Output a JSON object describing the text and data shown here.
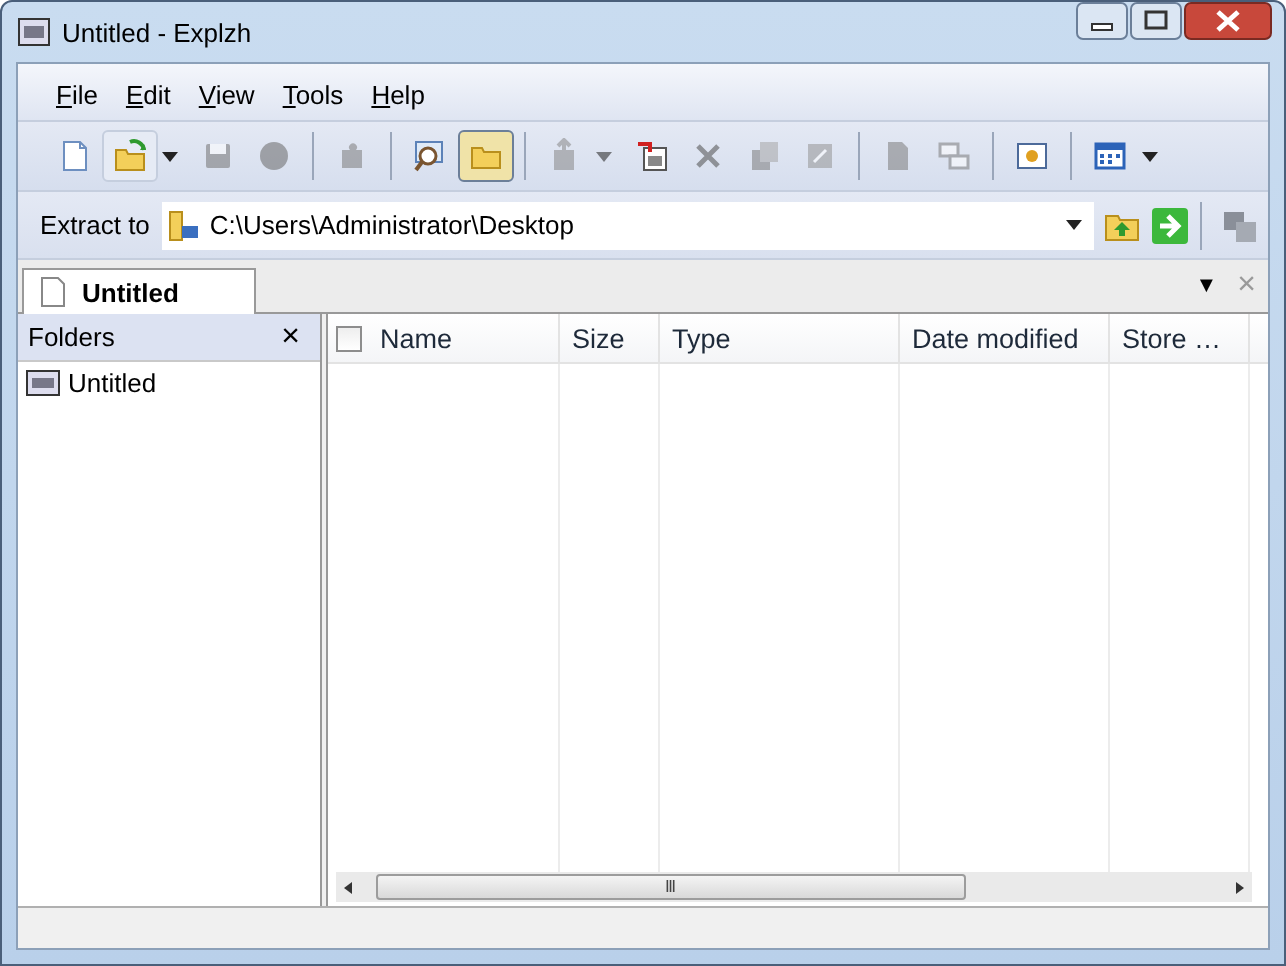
{
  "window": {
    "title": "Untitled - Explzh"
  },
  "menu": [
    "File",
    "Edit",
    "View",
    "Tools",
    "Help"
  ],
  "toolbar": [
    {
      "kind": "button",
      "disabled": false,
      "selected": false
    },
    {
      "kind": "split",
      "disabled": false,
      "selected": false
    },
    {
      "kind": "button",
      "disabled": true,
      "selected": false
    },
    {
      "kind": "button",
      "disabled": true,
      "selected": false
    },
    {
      "kind": "separator"
    },
    {
      "kind": "button",
      "disabled": true,
      "selected": false
    },
    {
      "kind": "separator"
    },
    {
      "kind": "button",
      "disabled": false,
      "selected": false
    },
    {
      "kind": "button",
      "disabled": false,
      "selected": true
    },
    {
      "kind": "separator"
    },
    {
      "kind": "split",
      "disabled": true,
      "selected": false
    },
    {
      "kind": "button",
      "disabled": false,
      "selected": false
    },
    {
      "kind": "button",
      "disabled": true,
      "selected": false
    },
    {
      "kind": "button",
      "disabled": true,
      "selected": false
    },
    {
      "kind": "button",
      "disabled": true,
      "selected": false
    },
    {
      "kind": "separator"
    },
    {
      "kind": "button",
      "disabled": true,
      "selected": false
    },
    {
      "kind": "button",
      "disabled": true,
      "selected": false
    },
    {
      "kind": "separator"
    },
    {
      "kind": "button",
      "disabled": false,
      "selected": false
    },
    {
      "kind": "separator"
    },
    {
      "kind": "split",
      "disabled": false,
      "selected": false
    }
  ],
  "extract": {
    "label": "Extract to",
    "value": "C:\\Users\\Administrator\\Desktop"
  },
  "tabs": [
    {
      "label": "Untitled",
      "selected": true
    }
  ],
  "tab_strip": {
    "menu": "▼",
    "close": "×"
  },
  "folders": {
    "title": "Folders",
    "close": "×",
    "tree": [
      {
        "label": "Untitled"
      }
    ]
  },
  "table": {
    "select_all": {
      "checked": false
    },
    "columns": [
      "Name",
      "Size",
      "Type",
      "Date modified",
      "Store …"
    ]
  },
  "scrollbar": {
    "grip": "Ⅲ"
  }
}
